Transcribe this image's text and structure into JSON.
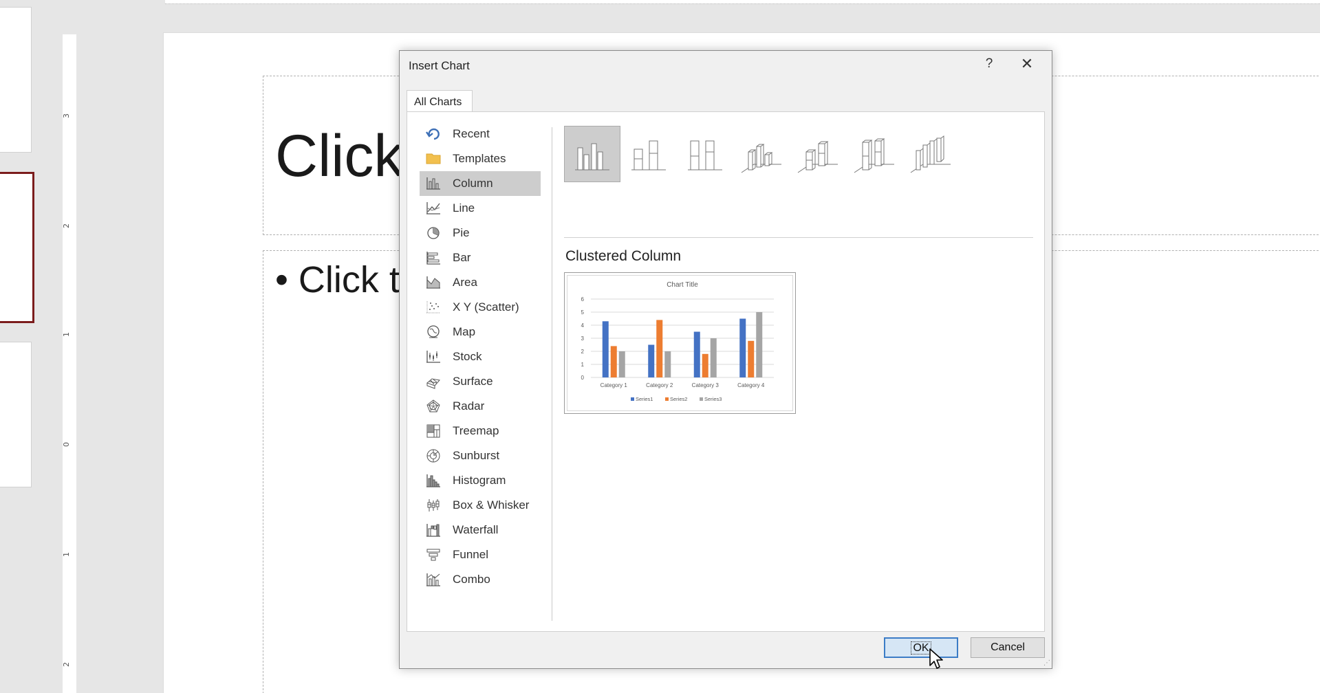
{
  "background": {
    "slide_title": "Click",
    "slide_bullet": "Click t",
    "ruler_numbers": [
      "3",
      "2",
      "1",
      "0",
      "1",
      "2"
    ]
  },
  "dialog": {
    "title": "Insert Chart",
    "help_label": "?",
    "close_label": "✕",
    "tab_label": "All Charts",
    "chart_types": [
      {
        "label": "Recent",
        "icon": "recent-icon"
      },
      {
        "label": "Templates",
        "icon": "folder-icon"
      },
      {
        "label": "Column",
        "icon": "column-chart-icon",
        "selected": true
      },
      {
        "label": "Line",
        "icon": "line-chart-icon"
      },
      {
        "label": "Pie",
        "icon": "pie-chart-icon"
      },
      {
        "label": "Bar",
        "icon": "bar-chart-icon"
      },
      {
        "label": "Area",
        "icon": "area-chart-icon"
      },
      {
        "label": "X Y (Scatter)",
        "icon": "scatter-chart-icon"
      },
      {
        "label": "Map",
        "icon": "map-chart-icon"
      },
      {
        "label": "Stock",
        "icon": "stock-chart-icon"
      },
      {
        "label": "Surface",
        "icon": "surface-chart-icon"
      },
      {
        "label": "Radar",
        "icon": "radar-chart-icon"
      },
      {
        "label": "Treemap",
        "icon": "treemap-chart-icon"
      },
      {
        "label": "Sunburst",
        "icon": "sunburst-chart-icon"
      },
      {
        "label": "Histogram",
        "icon": "histogram-chart-icon"
      },
      {
        "label": "Box & Whisker",
        "icon": "box-whisker-chart-icon"
      },
      {
        "label": "Waterfall",
        "icon": "waterfall-chart-icon"
      },
      {
        "label": "Funnel",
        "icon": "funnel-chart-icon"
      },
      {
        "label": "Combo",
        "icon": "combo-chart-icon"
      }
    ],
    "subtype_icons": [
      "clustered-column-icon",
      "stacked-column-icon",
      "100-stacked-column-icon",
      "3d-clustered-column-icon",
      "3d-stacked-column-icon",
      "3d-100-stacked-column-icon",
      "3d-column-icon"
    ],
    "selected_subtype_name": "Clustered Column",
    "ok_label": "OK",
    "cancel_label": "Cancel"
  },
  "colors": {
    "series1": "#4472c4",
    "series2": "#ed7d31",
    "series3": "#a5a5a5",
    "selection": "#cdcdcd",
    "slide_selected_border": "#7b1c1c"
  },
  "chart_data": {
    "type": "bar",
    "title": "Chart Title",
    "categories": [
      "Category 1",
      "Category 2",
      "Category 3",
      "Category 4"
    ],
    "series": [
      {
        "name": "Series1",
        "values": [
          4.3,
          2.5,
          3.5,
          4.5
        ]
      },
      {
        "name": "Series2",
        "values": [
          2.4,
          4.4,
          1.8,
          2.8
        ]
      },
      {
        "name": "Series3",
        "values": [
          2,
          2,
          3,
          5
        ]
      }
    ],
    "yticks": [
      "0",
      "1",
      "2",
      "3",
      "4",
      "5",
      "6"
    ],
    "ylim": [
      0,
      6
    ],
    "grid": true,
    "legend": "bottom"
  }
}
